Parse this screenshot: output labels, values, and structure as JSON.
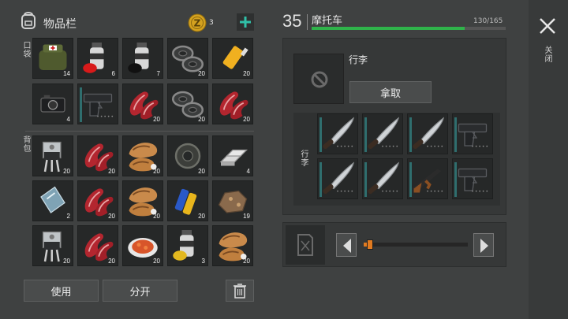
{
  "inventory": {
    "title": "物品栏",
    "coin_count": "3",
    "pocket_label": "口袋",
    "backpack_label": "背包",
    "pocket_items": [
      {
        "icon": "medkit-bag-icon",
        "count": "14"
      },
      {
        "icon": "spray-paint-red-icon",
        "count": "6"
      },
      {
        "icon": "spray-paint-black-icon",
        "count": "7"
      },
      {
        "icon": "washers-icon",
        "count": "20"
      },
      {
        "icon": "glue-tube-icon",
        "count": "20"
      },
      {
        "icon": "camera-icon",
        "count": "4"
      },
      {
        "icon": "pistol-icon",
        "count": ""
      },
      {
        "icon": "raw-meat-icon",
        "count": "20"
      },
      {
        "icon": "washers-icon",
        "count": "20"
      },
      {
        "icon": "raw-meat-icon",
        "count": "20"
      }
    ],
    "backpack_items": [
      {
        "icon": "transistor-icon",
        "count": "20"
      },
      {
        "icon": "raw-meat-icon",
        "count": "20"
      },
      {
        "icon": "roasted-meat-icon",
        "count": "20"
      },
      {
        "icon": "tape-roll-icon",
        "count": "20"
      },
      {
        "icon": "metal-ingots-icon",
        "count": "4"
      },
      {
        "icon": "glass-pane-icon",
        "count": "2"
      },
      {
        "icon": "raw-meat-icon",
        "count": "20"
      },
      {
        "icon": "roasted-meat-icon",
        "count": "20"
      },
      {
        "icon": "batteries-icon",
        "count": "20"
      },
      {
        "icon": "ore-rock-icon",
        "count": "19"
      },
      {
        "icon": "transistor-icon",
        "count": "20"
      },
      {
        "icon": "raw-meat-icon",
        "count": "20"
      },
      {
        "icon": "salad-plate-icon",
        "count": "20"
      },
      {
        "icon": "spray-paint-yellow-icon",
        "count": "3"
      },
      {
        "icon": "roasted-meat-icon",
        "count": "20"
      }
    ],
    "use_label": "使用",
    "split_label": "分开"
  },
  "vehicle": {
    "level": "35",
    "name": "摩托车",
    "capacity_text": "130/165",
    "capacity_fraction": 0.79,
    "luggage_title": "行李",
    "take_label": "拿取",
    "luggage_label": "行李",
    "luggage_items": [
      {
        "icon": "machete-icon"
      },
      {
        "icon": "machete-icon"
      },
      {
        "icon": "machete-icon"
      },
      {
        "icon": "pistol-icon"
      },
      {
        "icon": "machete-icon"
      },
      {
        "icon": "machete-icon"
      },
      {
        "icon": "assault-rifle-icon"
      },
      {
        "icon": "pistol-icon"
      }
    ],
    "fuel_fraction": 0.06
  },
  "close_label": "关闭",
  "colors": {
    "accent_green": "#2fb34a",
    "fuel_orange": "#e07a20",
    "slot_bg": "#262828"
  }
}
